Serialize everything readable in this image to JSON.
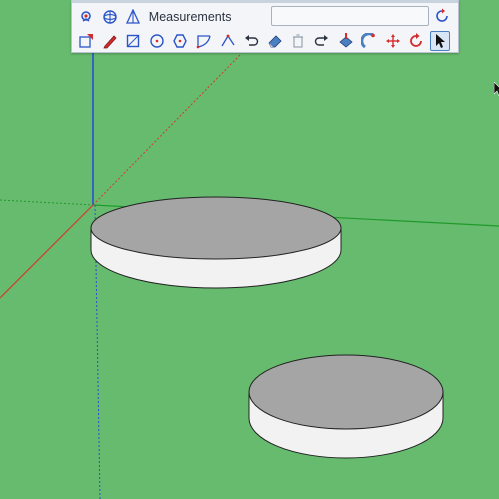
{
  "viewport": {
    "background_color": "#66bb6e",
    "axis_colors": {
      "red": "#d23a2a",
      "green": "#1f9a2a",
      "blue": "#2b4fd6"
    },
    "shapes": [
      {
        "name": "large-disc",
        "top_color": "#a5a5a5",
        "side_color": "#f2f2f2"
      },
      {
        "name": "small-disc",
        "top_color": "#a5a5a5",
        "side_color": "#f2f2f2"
      }
    ]
  },
  "toolbar": {
    "measurements_label": "Measurements",
    "measurements_value": "",
    "row1_icons": [
      "position-camera-icon",
      "orbit-icon",
      "section-plane-icon"
    ],
    "row2_icons": [
      "select-box-icon",
      "pencil-icon",
      "rectangle-icon",
      "circle-icon",
      "polygon-icon",
      "arc-icon",
      "freehand-icon",
      "undo-icon",
      "eraser-icon",
      "trash-icon",
      "redo-icon",
      "paint-bucket-icon",
      "follow-me-icon",
      "move-icon",
      "rotate-icon",
      "select-arrow-icon"
    ],
    "active_tool": "select-arrow-icon"
  }
}
